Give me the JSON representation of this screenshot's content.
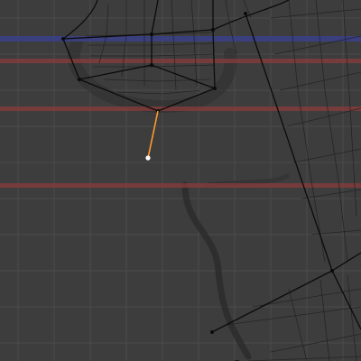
{
  "viewport": {
    "background": "#3d3d3d",
    "grid_color": "#4a4a4a",
    "cage_color": "#0b0b0b",
    "mesh_wire_color": "#202020",
    "shadow_color": "#2a2a2a",
    "guide_red": "#8a3b3b",
    "guide_blue": "#3a3f88",
    "selected_edge_color": "#ff9a2e",
    "selected_vertex_color": "#ffffff"
  },
  "guides": {
    "horizontal": [
      {
        "color_key": "guide_blue",
        "role": "axis-guide"
      },
      {
        "color_key": "guide_red",
        "role": "axis-guide"
      },
      {
        "color_key": "guide_red",
        "role": "axis-guide"
      },
      {
        "color_key": "guide_red",
        "role": "axis-guide"
      }
    ]
  },
  "selection": {
    "type": "edge",
    "vertex": "selected"
  }
}
